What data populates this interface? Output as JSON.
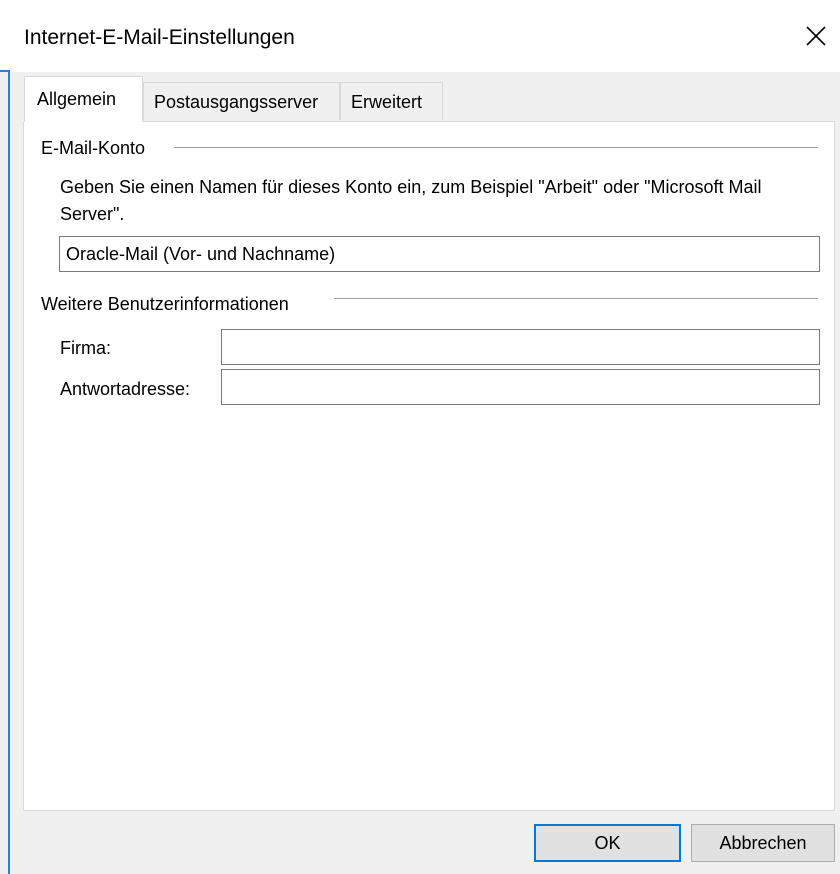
{
  "window": {
    "title": "Internet-E-Mail-Einstellungen",
    "accent_color": "#0078d7"
  },
  "titlebar": {
    "close_icon": "close-icon"
  },
  "tabs": [
    {
      "label": "Allgemein",
      "active": true
    },
    {
      "label": "Postausgangsserver",
      "active": false
    },
    {
      "label": "Erweitert",
      "active": false
    }
  ],
  "email_account": {
    "group_label": "E-Mail-Konto",
    "description": "Geben Sie einen Namen für dieses Konto ein, zum Beispiel \"Arbeit\" oder \"Microsoft Mail Server\".",
    "account_name_value": "Oracle-Mail (Vor- und Nachname)"
  },
  "user_info": {
    "group_label": "Weitere Benutzerinformationen",
    "company_label": "Firma:",
    "company_value": "",
    "reply_label": "Antwortadresse:",
    "reply_value": ""
  },
  "buttons": {
    "ok_label": "OK",
    "cancel_label": "Abbrechen"
  }
}
